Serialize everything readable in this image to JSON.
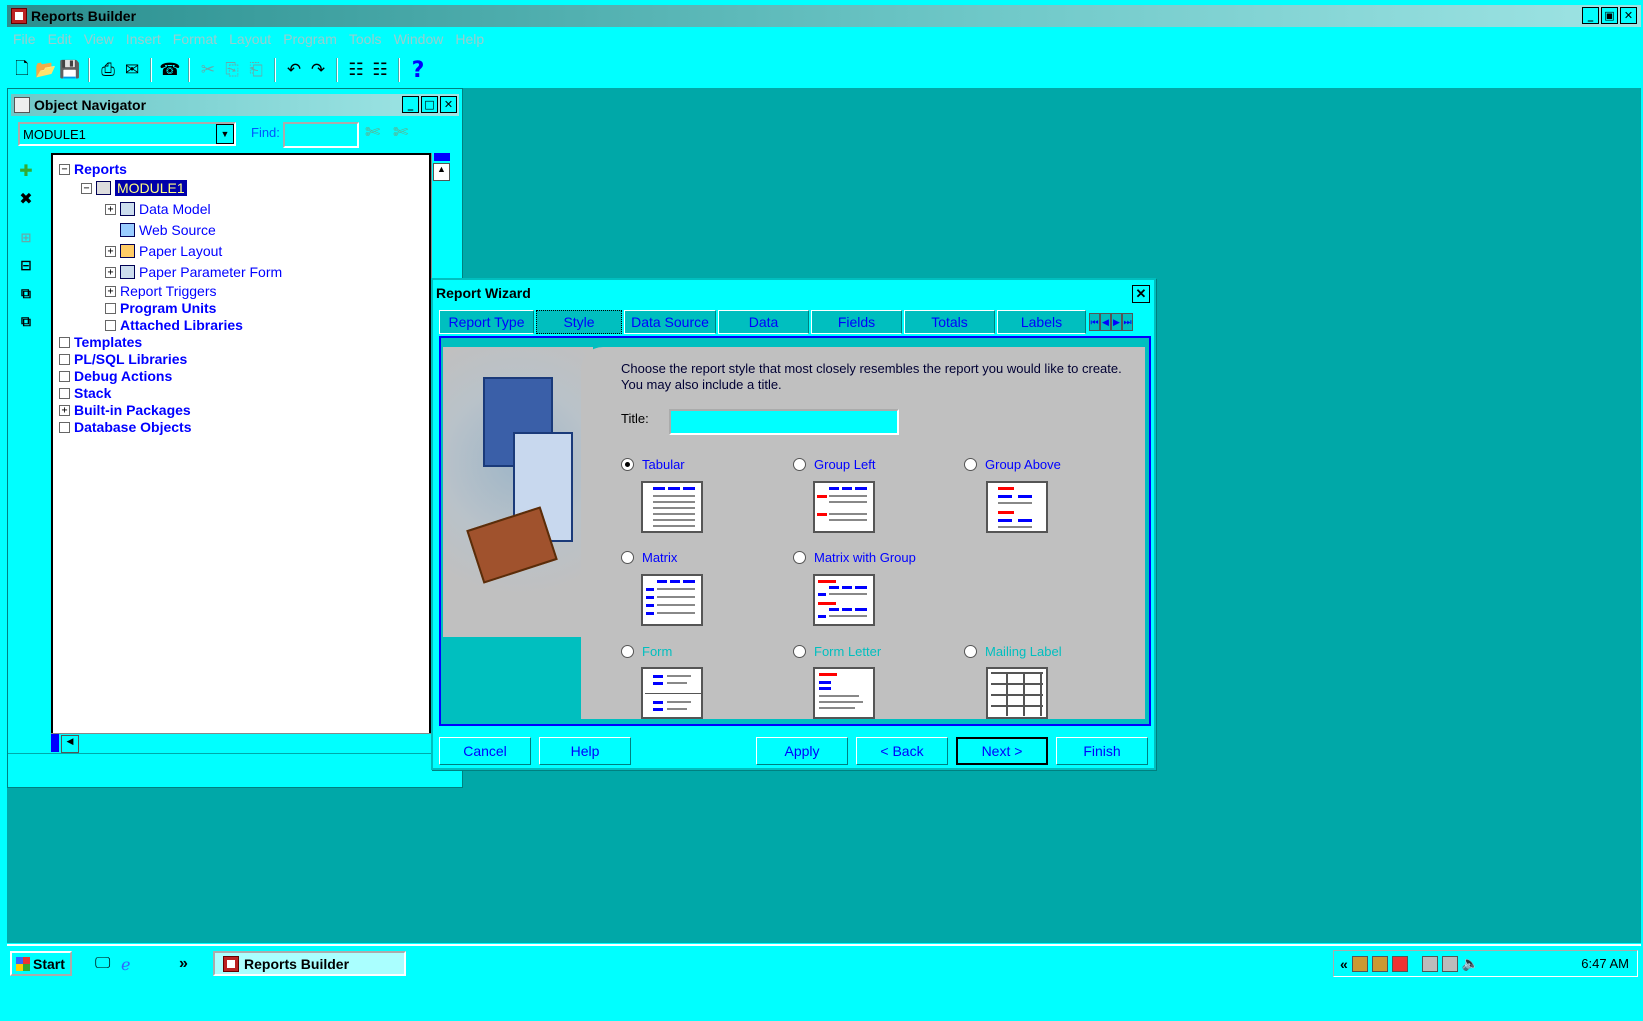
{
  "app": {
    "title": "Reports Builder",
    "menu": [
      "File",
      "Edit",
      "View",
      "Insert",
      "Format",
      "Layout",
      "Program",
      "Tools",
      "Window",
      "Help"
    ],
    "window_controls": [
      "_",
      "ř",
      "✕"
    ]
  },
  "navigator": {
    "title": "Object Navigator",
    "module_select": "MODULE1",
    "find_label": "Find:",
    "find_value": "",
    "tree": [
      {
        "label": "Reports",
        "toggle": "−",
        "bold": true
      },
      {
        "label": "MODULE1",
        "toggle": "−",
        "selected": true
      },
      {
        "label": "Data Model",
        "toggle": "+"
      },
      {
        "label": "Web Source",
        "toggle": ""
      },
      {
        "label": "Paper Layout",
        "toggle": "+"
      },
      {
        "label": "Paper Parameter Form",
        "toggle": "+"
      },
      {
        "label": "Report Triggers",
        "toggle": "+"
      },
      {
        "label": "Program Units",
        "toggle": " ",
        "bold": true
      },
      {
        "label": "Attached Libraries",
        "toggle": " ",
        "bold": true
      },
      {
        "label": "Templates",
        "toggle": " ",
        "bold": true
      },
      {
        "label": "PL/SQL Libraries",
        "toggle": " ",
        "bold": true
      },
      {
        "label": "Debug Actions",
        "toggle": " ",
        "bold": true
      },
      {
        "label": "Stack",
        "toggle": " ",
        "bold": true
      },
      {
        "label": "Built-in Packages",
        "toggle": "+",
        "bold": true
      },
      {
        "label": "Database Objects",
        "toggle": " ",
        "bold": true
      }
    ]
  },
  "wizard": {
    "title": "Report Wizard",
    "tabs": [
      "Report Type",
      "Style",
      "Data Source",
      "Data",
      "Fields",
      "Totals",
      "Labels"
    ],
    "active_tab": "Style",
    "description": "Choose the report style that most closely resembles the report you would like to create. You may also include a title.",
    "title_label": "Title:",
    "title_value": "",
    "styles": [
      {
        "label": "Tabular",
        "selected": true,
        "enabled": true
      },
      {
        "label": "Group Left",
        "selected": false,
        "enabled": true
      },
      {
        "label": "Group Above",
        "selected": false,
        "enabled": true
      },
      {
        "label": "Matrix",
        "selected": false,
        "enabled": true
      },
      {
        "label": "Matrix with Group",
        "selected": false,
        "enabled": true
      },
      {
        "label": "Form",
        "selected": false,
        "enabled": false
      },
      {
        "label": "Form Letter",
        "selected": false,
        "enabled": false
      },
      {
        "label": "Mailing Label",
        "selected": false,
        "enabled": false
      }
    ],
    "buttons": {
      "cancel": "Cancel",
      "help": "Help",
      "apply": "Apply",
      "back": "< Back",
      "next": "Next >",
      "finish": "Finish"
    }
  },
  "taskbar": {
    "start": "Start",
    "task": "Reports Builder",
    "clock": "6:47 AM",
    "chevron": "»",
    "tray_chevron": "«"
  },
  "colors": {
    "surface": "#00FFFF",
    "desktop": "#00A8A8",
    "link": "#0000FF",
    "selection": "#0000AA"
  }
}
